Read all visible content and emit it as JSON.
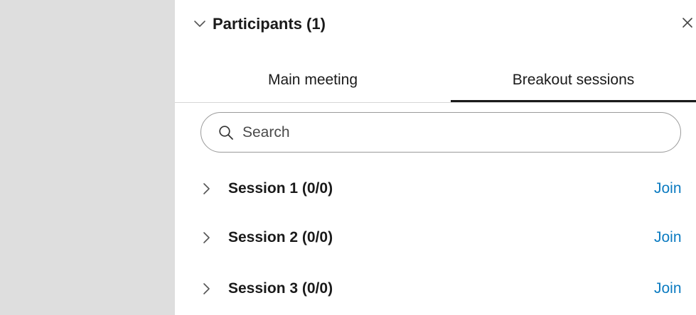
{
  "panel": {
    "title": "Participants (1)"
  },
  "tabs": [
    {
      "label": "Main meeting",
      "selected": false
    },
    {
      "label": "Breakout sessions",
      "selected": true
    }
  ],
  "search": {
    "placeholder": "Search",
    "value": ""
  },
  "sessions": [
    {
      "name": "Session 1 (0/0)",
      "action": "Join"
    },
    {
      "name": "Session 2 (0/0)",
      "action": "Join"
    },
    {
      "name": "Session 3 (0/0)",
      "action": "Join"
    }
  ],
  "icons": {
    "collapse": "chevron-down-icon",
    "close": "close-icon",
    "search": "search-icon",
    "expand": "chevron-right-icon"
  },
  "colors": {
    "accent": "#0b7bc1",
    "text": "#1a1a1a",
    "sidebar_bg": "#dedede",
    "divider": "#d6d6d6",
    "search_border": "#9a9a9a"
  }
}
